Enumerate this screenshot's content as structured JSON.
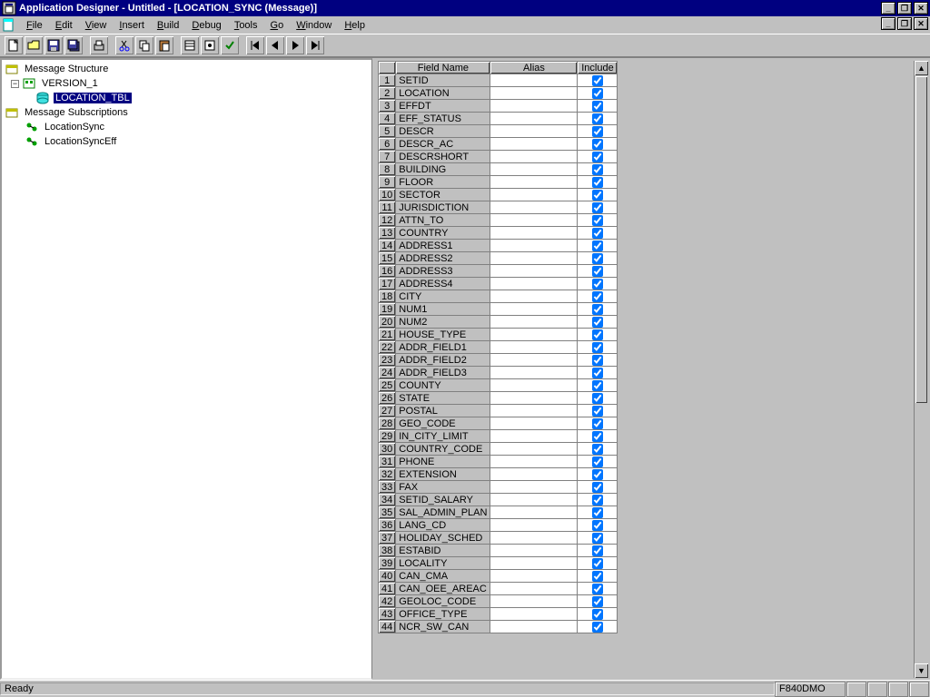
{
  "title": "Application Designer - Untitled - [LOCATION_SYNC (Message)]",
  "menu": {
    "file": "File",
    "edit": "Edit",
    "view": "View",
    "insert": "Insert",
    "build": "Build",
    "debug": "Debug",
    "tools": "Tools",
    "go": "Go",
    "window": "Window",
    "help": "Help"
  },
  "tree": {
    "root1": "Message Structure",
    "version": "VERSION_1",
    "table": "LOCATION_TBL",
    "root2": "Message Subscriptions",
    "sub1": "LocationSync",
    "sub2": "LocationSyncEff"
  },
  "grid": {
    "headers": {
      "field": "Field Name",
      "alias": "Alias",
      "include": "Include"
    },
    "rows": [
      {
        "n": 1,
        "field": "SETID",
        "alias": "",
        "include": true
      },
      {
        "n": 2,
        "field": "LOCATION",
        "alias": "",
        "include": true
      },
      {
        "n": 3,
        "field": "EFFDT",
        "alias": "",
        "include": true
      },
      {
        "n": 4,
        "field": "EFF_STATUS",
        "alias": "",
        "include": true
      },
      {
        "n": 5,
        "field": "DESCR",
        "alias": "",
        "include": true
      },
      {
        "n": 6,
        "field": "DESCR_AC",
        "alias": "",
        "include": true
      },
      {
        "n": 7,
        "field": "DESCRSHORT",
        "alias": "",
        "include": true
      },
      {
        "n": 8,
        "field": "BUILDING",
        "alias": "",
        "include": true
      },
      {
        "n": 9,
        "field": "FLOOR",
        "alias": "",
        "include": true
      },
      {
        "n": 10,
        "field": "SECTOR",
        "alias": "",
        "include": true
      },
      {
        "n": 11,
        "field": "JURISDICTION",
        "alias": "",
        "include": true
      },
      {
        "n": 12,
        "field": "ATTN_TO",
        "alias": "",
        "include": true
      },
      {
        "n": 13,
        "field": "COUNTRY",
        "alias": "",
        "include": true
      },
      {
        "n": 14,
        "field": "ADDRESS1",
        "alias": "",
        "include": true
      },
      {
        "n": 15,
        "field": "ADDRESS2",
        "alias": "",
        "include": true
      },
      {
        "n": 16,
        "field": "ADDRESS3",
        "alias": "",
        "include": true
      },
      {
        "n": 17,
        "field": "ADDRESS4",
        "alias": "",
        "include": true
      },
      {
        "n": 18,
        "field": "CITY",
        "alias": "",
        "include": true
      },
      {
        "n": 19,
        "field": "NUM1",
        "alias": "",
        "include": true
      },
      {
        "n": 20,
        "field": "NUM2",
        "alias": "",
        "include": true
      },
      {
        "n": 21,
        "field": "HOUSE_TYPE",
        "alias": "",
        "include": true
      },
      {
        "n": 22,
        "field": "ADDR_FIELD1",
        "alias": "",
        "include": true
      },
      {
        "n": 23,
        "field": "ADDR_FIELD2",
        "alias": "",
        "include": true
      },
      {
        "n": 24,
        "field": "ADDR_FIELD3",
        "alias": "",
        "include": true
      },
      {
        "n": 25,
        "field": "COUNTY",
        "alias": "",
        "include": true
      },
      {
        "n": 26,
        "field": "STATE",
        "alias": "",
        "include": true
      },
      {
        "n": 27,
        "field": "POSTAL",
        "alias": "",
        "include": true
      },
      {
        "n": 28,
        "field": "GEO_CODE",
        "alias": "",
        "include": true
      },
      {
        "n": 29,
        "field": "IN_CITY_LIMIT",
        "alias": "",
        "include": true
      },
      {
        "n": 30,
        "field": "COUNTRY_CODE",
        "alias": "",
        "include": true
      },
      {
        "n": 31,
        "field": "PHONE",
        "alias": "",
        "include": true
      },
      {
        "n": 32,
        "field": "EXTENSION",
        "alias": "",
        "include": true
      },
      {
        "n": 33,
        "field": "FAX",
        "alias": "",
        "include": true
      },
      {
        "n": 34,
        "field": "SETID_SALARY",
        "alias": "",
        "include": true
      },
      {
        "n": 35,
        "field": "SAL_ADMIN_PLAN",
        "alias": "",
        "include": true
      },
      {
        "n": 36,
        "field": "LANG_CD",
        "alias": "",
        "include": true
      },
      {
        "n": 37,
        "field": "HOLIDAY_SCHED",
        "alias": "",
        "include": true
      },
      {
        "n": 38,
        "field": "ESTABID",
        "alias": "",
        "include": true
      },
      {
        "n": 39,
        "field": "LOCALITY",
        "alias": "",
        "include": true
      },
      {
        "n": 40,
        "field": "CAN_CMA",
        "alias": "",
        "include": true
      },
      {
        "n": 41,
        "field": "CAN_OEE_AREAC",
        "alias": "",
        "include": true
      },
      {
        "n": 42,
        "field": "GEOLOC_CODE",
        "alias": "",
        "include": true
      },
      {
        "n": 43,
        "field": "OFFICE_TYPE",
        "alias": "",
        "include": true
      },
      {
        "n": 44,
        "field": "NCR_SW_CAN",
        "alias": "",
        "include": true
      }
    ]
  },
  "status": {
    "ready": "Ready",
    "db": "F840DMO"
  }
}
